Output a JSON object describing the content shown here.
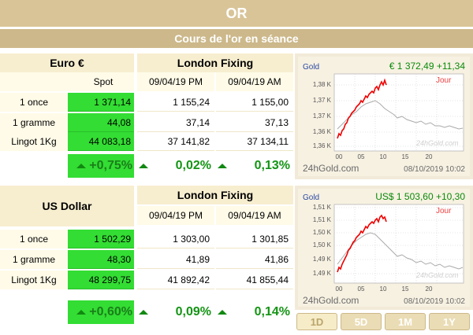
{
  "header": {
    "title": "OR",
    "subtitle": "Cours de l'or en séance"
  },
  "euro": {
    "currency": "Euro €",
    "fixing_title": "London Fixing",
    "spot_label": "Spot",
    "col_pm": "09/04/19 PM",
    "col_am": "09/04/19 AM",
    "rows": [
      {
        "label": "1 once",
        "spot": "1 371,14",
        "pm": "1 155,24",
        "am": "1 155,00"
      },
      {
        "label": "1 gramme",
        "spot": "44,08",
        "pm": "37,14",
        "am": "37,13"
      },
      {
        "label": "Lingot 1Kg",
        "spot": "44 083,18",
        "pm": "37 141,82",
        "am": "37 134,11"
      }
    ],
    "change_spot": "+0,75%",
    "change_pm": "0,02%",
    "change_am": "0,13%",
    "chart": {
      "brand": "Gold",
      "price_text": "€ 1 372,49 +11,34",
      "jour_label": "Jour",
      "yticks": [
        "1,38 K",
        "1,37 K",
        "1,37 K",
        "1,36 K",
        "1,36 K"
      ],
      "xticks": [
        "00",
        "05",
        "10",
        "15",
        "20"
      ],
      "watermark": "24hGold.com",
      "footer_left": "24hGold.com",
      "footer_right": "08/10/2019 10:02"
    }
  },
  "usd": {
    "currency": "US Dollar",
    "fixing_title": "London Fixing",
    "col_pm": "09/04/19 PM",
    "col_am": "09/04/19 AM",
    "rows": [
      {
        "label": "1 once",
        "spot": "1 502,29",
        "pm": "1 303,00",
        "am": "1 301,85"
      },
      {
        "label": "1 gramme",
        "spot": "48,30",
        "pm": "41,89",
        "am": "41,86"
      },
      {
        "label": "Lingot 1Kg",
        "spot": "48 299,75",
        "pm": "41 892,42",
        "am": "41 855,44"
      }
    ],
    "change_spot": "+0,60%",
    "change_pm": "0,09%",
    "change_am": "0,14%",
    "chart": {
      "brand": "Gold",
      "price_text": "US$ 1 503,60 +10,30",
      "jour_label": "Jour",
      "yticks": [
        "1,51 K",
        "1,51 K",
        "1,50 K",
        "1,50 K",
        "1,49 K",
        "1,49 K"
      ],
      "xticks": [
        "00",
        "05",
        "10",
        "15",
        "20"
      ],
      "watermark": "24hGold.com",
      "footer_left": "24hGold.com",
      "footer_right": "08/10/2019 10:02"
    }
  },
  "period_buttons": [
    "1D",
    "5D",
    "1M",
    "1Y"
  ],
  "colors": {
    "spot_green": "#33dd33",
    "chart_red": "#ee0000",
    "header_tan": "#d9c498"
  }
}
